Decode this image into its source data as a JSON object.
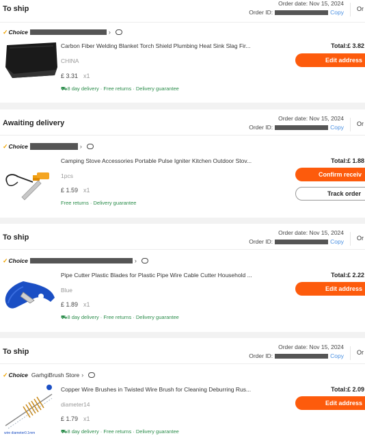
{
  "orders": [
    {
      "status": "To ship",
      "order_date": "Order date: Nov 15, 2024",
      "order_id_label": "Order ID:",
      "copy_label": "Copy",
      "more_label": "Or",
      "store_badge": "Choice",
      "store_name": "",
      "product_title": "Carbon Fiber Welding Blanket Torch Shield Plumbing Heat Sink Slag Fir...",
      "variant": "CHINA",
      "price": "£ 3.31",
      "qty": "x1",
      "delivery": "8 day delivery · Free returns · Delivery guarantee",
      "total": "Total:£ 3.82",
      "primary_action": "Edit address"
    },
    {
      "status": "Awaiting delivery",
      "order_date": "Order date: Nov 15, 2024",
      "order_id_label": "Order ID:",
      "copy_label": "Copy",
      "more_label": "Or",
      "store_badge": "Choice",
      "store_name": "",
      "product_title": "Camping Stove Accessories Portable Pulse Igniter Kitchen Outdoor Stov...",
      "variant": "1pcs",
      "price": "£ 1.59",
      "qty": "x1",
      "delivery": "Free returns · Delivery guarantee",
      "total": "Total:£ 1.88",
      "primary_action": "Confirm receiv",
      "secondary_action": "Track order"
    },
    {
      "status": "To ship",
      "order_date": "Order date: Nov 15, 2024",
      "order_id_label": "Order ID:",
      "copy_label": "Copy",
      "more_label": "Or",
      "store_badge": "Choice",
      "store_name": "",
      "product_title": "Pipe Cutter Plastic Blades for Plastic Pipe Wire Cable Cutter Household ...",
      "variant": "Blue",
      "price": "£ 1.89",
      "qty": "x1",
      "delivery": "8 day delivery · Free returns · Delivery guarantee",
      "total": "Total:£ 2.22",
      "primary_action": "Edit address"
    },
    {
      "status": "To ship",
      "order_date": "Order date: Nov 15, 2024",
      "order_id_label": "Order ID:",
      "copy_label": "Copy",
      "more_label": "Or",
      "store_badge": "Choice",
      "store_name": "GarhgiBrush Store",
      "product_title": "Copper Wire Brushes in Twisted Wire Brush for Cleaning Deburring Rus...",
      "variant": "diameter14",
      "price": "£ 1.79",
      "qty": "x1",
      "delivery": "8 day delivery · Free returns · Delivery guarantee",
      "total": "Total:£ 2.09",
      "primary_action": "Edit address",
      "thumb_caption": "wire diameter0.1mm"
    }
  ],
  "colors": {
    "accent": "#fd5b0c",
    "link": "#4a90e2",
    "delivery": "#2a8c4a",
    "choice_tick": "#f0a500"
  }
}
